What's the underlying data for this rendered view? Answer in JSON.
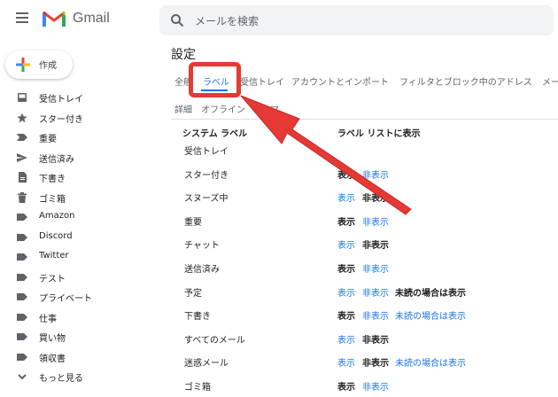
{
  "header": {
    "brand": "Gmail",
    "search_placeholder": "メールを検索"
  },
  "compose": {
    "label": "作成"
  },
  "sidebar": {
    "items": [
      {
        "label": "受信トレイ",
        "icon": "inbox-icon"
      },
      {
        "label": "スター付き",
        "icon": "star-icon"
      },
      {
        "label": "重要",
        "icon": "important-icon"
      },
      {
        "label": "送信済み",
        "icon": "send-icon"
      },
      {
        "label": "下書き",
        "icon": "draft-icon"
      },
      {
        "label": "ゴミ箱",
        "icon": "trash-icon"
      },
      {
        "label": "Amazon",
        "icon": "label-icon"
      },
      {
        "label": "Discord",
        "icon": "label-icon"
      },
      {
        "label": "Twitter",
        "icon": "label-icon"
      },
      {
        "label": "テスト",
        "icon": "label-icon"
      },
      {
        "label": "プライベート",
        "icon": "label-icon"
      },
      {
        "label": "仕事",
        "icon": "label-icon"
      },
      {
        "label": "買い物",
        "icon": "label-icon"
      },
      {
        "label": "領収書",
        "icon": "label-icon"
      },
      {
        "label": "もっと見る",
        "icon": "chevron-down-icon"
      }
    ]
  },
  "settings": {
    "title": "設定",
    "tabs": [
      "全般",
      "ラベル",
      "受信トレイ",
      "アカウントとインポート",
      "フィルタとブロック中のアドレス",
      "メー"
    ],
    "tabs_row2": [
      "詳細",
      "オフライン",
      "テーマ"
    ],
    "active_tab": "ラベル"
  },
  "labels_table": {
    "header_name": "システム ラベル",
    "header_show": "ラベル リストに表示",
    "rows": [
      {
        "name": "受信トレイ",
        "options": []
      },
      {
        "name": "スター付き",
        "options": [
          {
            "text": "表示",
            "selected": true
          },
          {
            "text": "非表示",
            "selected": false
          }
        ]
      },
      {
        "name": "スヌーズ中",
        "options": [
          {
            "text": "表示",
            "selected": false
          },
          {
            "text": "非表示",
            "selected": true
          }
        ]
      },
      {
        "name": "重要",
        "options": [
          {
            "text": "表示",
            "selected": true
          },
          {
            "text": "非表示",
            "selected": false
          }
        ]
      },
      {
        "name": "チャット",
        "options": [
          {
            "text": "表示",
            "selected": false
          },
          {
            "text": "非表示",
            "selected": true
          }
        ]
      },
      {
        "name": "送信済み",
        "options": [
          {
            "text": "表示",
            "selected": true
          },
          {
            "text": "非表示",
            "selected": false
          }
        ]
      },
      {
        "name": "予定",
        "options": [
          {
            "text": "表示",
            "selected": false
          },
          {
            "text": "非表示",
            "selected": false
          },
          {
            "text": "未読の場合は表示",
            "selected": true
          }
        ]
      },
      {
        "name": "下書き",
        "options": [
          {
            "text": "表示",
            "selected": true
          },
          {
            "text": "非表示",
            "selected": false
          },
          {
            "text": "未読の場合は表示",
            "selected": false
          }
        ]
      },
      {
        "name": "すべてのメール",
        "options": [
          {
            "text": "表示",
            "selected": false
          },
          {
            "text": "非表示",
            "selected": true
          }
        ]
      },
      {
        "name": "迷惑メール",
        "options": [
          {
            "text": "表示",
            "selected": false
          },
          {
            "text": "非表示",
            "selected": true
          },
          {
            "text": "未読の場合は表示",
            "selected": false
          }
        ]
      },
      {
        "name": "ゴミ箱",
        "options": [
          {
            "text": "表示",
            "selected": true
          },
          {
            "text": "非表示",
            "selected": false
          }
        ]
      }
    ]
  },
  "colors": {
    "link": "#1a73e8",
    "annotation": "#e53935"
  }
}
